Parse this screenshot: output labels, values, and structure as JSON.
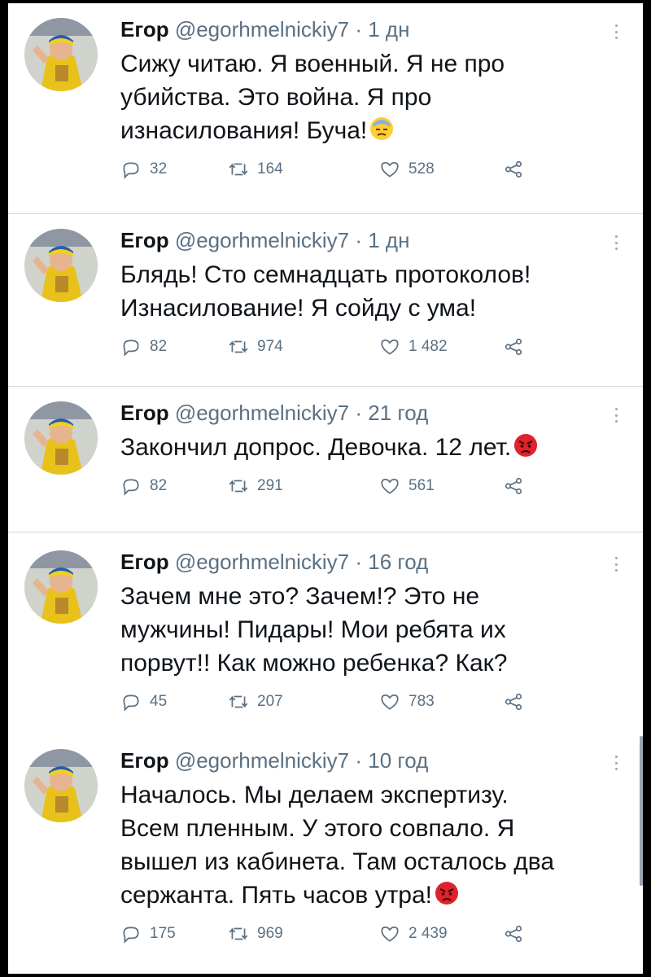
{
  "tweets": [
    {
      "name": "Егор",
      "handle": "@egorhmelnickiy7",
      "dot": "·",
      "time": "1 дн",
      "lines": [
        "Сижу читаю. Я военный. Я не про",
        "убийства. Это война. Я про",
        "изнасилования! Буча!"
      ],
      "emoji": "sad-sweat-emoji",
      "reply_count": "32",
      "retweet_count": "164",
      "like_count": "528"
    },
    {
      "name": "Егор",
      "handle": "@egorhmelnickiy7",
      "dot": "·",
      "time": "1 дн",
      "lines": [
        "Блядь! Сто семнадцать протоколов!",
        "Изнасилование! Я сойду с ума!"
      ],
      "emoji": "",
      "reply_count": "82",
      "retweet_count": "974",
      "like_count": "1 482"
    },
    {
      "name": "Егор",
      "handle": "@egorhmelnickiy7",
      "dot": "·",
      "time": "21 год",
      "lines": [
        "Закончил допрос. Девочка. 12 лет."
      ],
      "emoji": "angry-face-emoji",
      "reply_count": "82",
      "retweet_count": "291",
      "like_count": "561"
    },
    {
      "name": "Егор",
      "handle": "@egorhmelnickiy7",
      "dot": "·",
      "time": "16 год",
      "lines": [
        "Зачем мне это? Зачем!? Это не",
        "мужчины! Пидары! Мои ребята их",
        "порвут!! Как можно ребенка? Как?"
      ],
      "emoji": "",
      "reply_count": "45",
      "retweet_count": "207",
      "like_count": "783"
    },
    {
      "name": "Егор",
      "handle": "@egorhmelnickiy7",
      "dot": "·",
      "time": "10 год",
      "lines": [
        "Началось. Мы делаем экспертизу.",
        "Всем пленным. У этого совпало. Я",
        "вышел из кабинета. Там осталось два",
        "сержанта. Пять часов утра!"
      ],
      "emoji": "angry-face-emoji",
      "reply_count": "175",
      "retweet_count": "969",
      "like_count": "2 439"
    }
  ],
  "icons": {
    "reply": "reply-icon",
    "retweet": "retweet-icon",
    "like": "heart-icon",
    "share": "share-icon",
    "more": "more-options-icon"
  },
  "colors": {
    "secondary_text": "#5b7083",
    "primary_text": "#0f1419",
    "background": "#ffffff",
    "frame": "#000000"
  }
}
